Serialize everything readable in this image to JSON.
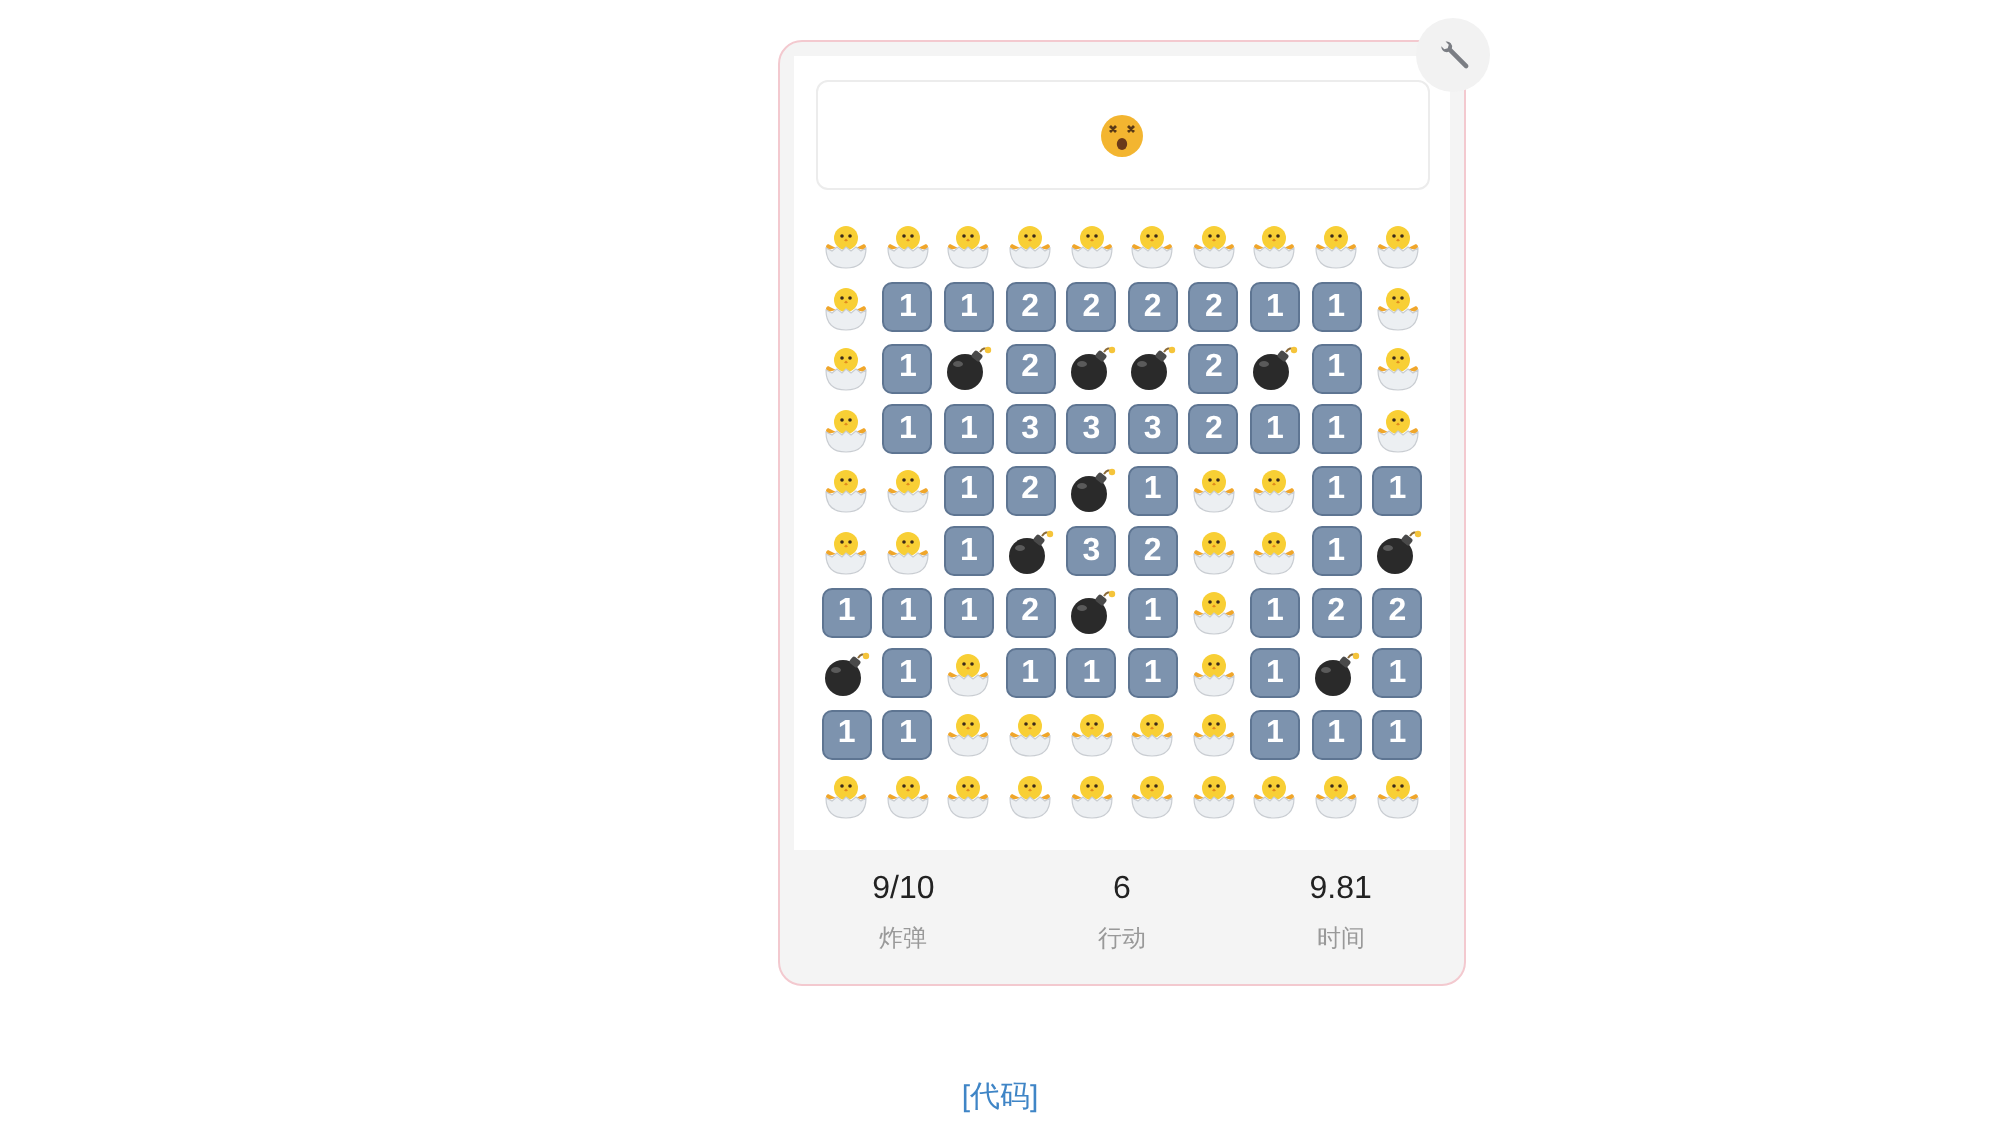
{
  "status_face": {
    "kind": "dizzy"
  },
  "grid": {
    "rows": [
      [
        {
          "kind": "chick"
        },
        {
          "kind": "chick"
        },
        {
          "kind": "chick"
        },
        {
          "kind": "chick"
        },
        {
          "kind": "chick"
        },
        {
          "kind": "chick"
        },
        {
          "kind": "chick"
        },
        {
          "kind": "chick"
        },
        {
          "kind": "chick"
        },
        {
          "kind": "chick"
        }
      ],
      [
        {
          "kind": "chick"
        },
        {
          "kind": "number",
          "label": "1"
        },
        {
          "kind": "number",
          "label": "1"
        },
        {
          "kind": "number",
          "label": "2"
        },
        {
          "kind": "number",
          "label": "2"
        },
        {
          "kind": "number",
          "label": "2"
        },
        {
          "kind": "number",
          "label": "2"
        },
        {
          "kind": "number",
          "label": "1"
        },
        {
          "kind": "number",
          "label": "1"
        },
        {
          "kind": "chick"
        }
      ],
      [
        {
          "kind": "chick"
        },
        {
          "kind": "number",
          "label": "1"
        },
        {
          "kind": "bomb"
        },
        {
          "kind": "number",
          "label": "2"
        },
        {
          "kind": "bomb"
        },
        {
          "kind": "bomb"
        },
        {
          "kind": "number",
          "label": "2"
        },
        {
          "kind": "bomb"
        },
        {
          "kind": "number",
          "label": "1"
        },
        {
          "kind": "chick"
        }
      ],
      [
        {
          "kind": "chick"
        },
        {
          "kind": "number",
          "label": "1"
        },
        {
          "kind": "number",
          "label": "1"
        },
        {
          "kind": "number",
          "label": "3"
        },
        {
          "kind": "number",
          "label": "3"
        },
        {
          "kind": "number",
          "label": "3"
        },
        {
          "kind": "number",
          "label": "2"
        },
        {
          "kind": "number",
          "label": "1"
        },
        {
          "kind": "number",
          "label": "1"
        },
        {
          "kind": "chick"
        }
      ],
      [
        {
          "kind": "chick"
        },
        {
          "kind": "chick"
        },
        {
          "kind": "number",
          "label": "1"
        },
        {
          "kind": "number",
          "label": "2"
        },
        {
          "kind": "bomb"
        },
        {
          "kind": "number",
          "label": "1"
        },
        {
          "kind": "chick"
        },
        {
          "kind": "chick"
        },
        {
          "kind": "number",
          "label": "1"
        },
        {
          "kind": "number",
          "label": "1"
        }
      ],
      [
        {
          "kind": "chick"
        },
        {
          "kind": "chick"
        },
        {
          "kind": "number",
          "label": "1"
        },
        {
          "kind": "bomb"
        },
        {
          "kind": "number",
          "label": "3"
        },
        {
          "kind": "number",
          "label": "2"
        },
        {
          "kind": "chick"
        },
        {
          "kind": "chick"
        },
        {
          "kind": "number",
          "label": "1"
        },
        {
          "kind": "bomb"
        }
      ],
      [
        {
          "kind": "number",
          "label": "1"
        },
        {
          "kind": "number",
          "label": "1"
        },
        {
          "kind": "number",
          "label": "1"
        },
        {
          "kind": "number",
          "label": "2"
        },
        {
          "kind": "bomb"
        },
        {
          "kind": "number",
          "label": "1"
        },
        {
          "kind": "chick"
        },
        {
          "kind": "number",
          "label": "1"
        },
        {
          "kind": "number",
          "label": "2"
        },
        {
          "kind": "number",
          "label": "2"
        }
      ],
      [
        {
          "kind": "bomb"
        },
        {
          "kind": "number",
          "label": "1"
        },
        {
          "kind": "chick"
        },
        {
          "kind": "number",
          "label": "1"
        },
        {
          "kind": "number",
          "label": "1"
        },
        {
          "kind": "number",
          "label": "1"
        },
        {
          "kind": "chick"
        },
        {
          "kind": "number",
          "label": "1"
        },
        {
          "kind": "bomb"
        },
        {
          "kind": "number",
          "label": "1"
        }
      ],
      [
        {
          "kind": "number",
          "label": "1"
        },
        {
          "kind": "number",
          "label": "1"
        },
        {
          "kind": "chick"
        },
        {
          "kind": "chick"
        },
        {
          "kind": "chick"
        },
        {
          "kind": "chick"
        },
        {
          "kind": "chick"
        },
        {
          "kind": "number",
          "label": "1"
        },
        {
          "kind": "number",
          "label": "1"
        },
        {
          "kind": "number",
          "label": "1"
        }
      ],
      [
        {
          "kind": "chick"
        },
        {
          "kind": "chick"
        },
        {
          "kind": "chick"
        },
        {
          "kind": "chick"
        },
        {
          "kind": "chick"
        },
        {
          "kind": "chick"
        },
        {
          "kind": "chick"
        },
        {
          "kind": "chick"
        },
        {
          "kind": "chick"
        },
        {
          "kind": "chick"
        }
      ]
    ]
  },
  "stats": [
    {
      "value": "9/10",
      "label": "炸弹"
    },
    {
      "value": "6",
      "label": "行动"
    },
    {
      "value": "9.81",
      "label": "时间"
    }
  ],
  "link": "[代码]"
}
